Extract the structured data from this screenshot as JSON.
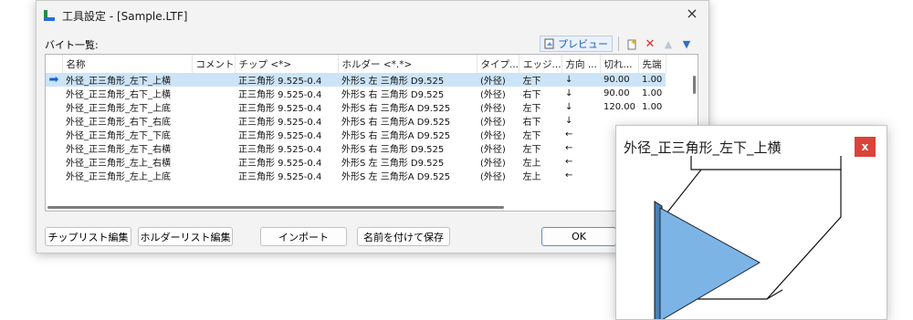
{
  "window": {
    "title": "工具設定 - [Sample.LTF]",
    "close": "×"
  },
  "list_label": "バイト一覧:",
  "toolbar": {
    "preview_label": "プレビュー",
    "icons": [
      "preview-icon",
      "new-icon",
      "delete-icon",
      "move-up-icon",
      "move-down-icon"
    ],
    "delete_color": "#d3302a"
  },
  "table": {
    "columns": [
      "名称",
      "コメント",
      "チップ <*>",
      "ホルダー <*.*>",
      "タイプ...",
      "エッジ...",
      "方向 ...",
      "切れ...",
      "先端"
    ],
    "rows": [
      {
        "name": "外径_正三角形_左下_上横",
        "comment": "",
        "tip": "正三角形 9.525-0.4",
        "holder": "外形S 左 三角形 D9.525",
        "type": "(外径)",
        "edge": "左下",
        "dir": "↓",
        "cut": "90.00",
        "tip2": "1.00",
        "selected": true
      },
      {
        "name": "外径_正三角形_右下_上横",
        "comment": "",
        "tip": "正三角形 9.525-0.4",
        "holder": "外形S 右 三角形 D9.525",
        "type": "(外径)",
        "edge": "右下",
        "dir": "↓",
        "cut": "90.00",
        "tip2": "1.00",
        "selected": false
      },
      {
        "name": "外径_正三角形_左下_上底",
        "comment": "",
        "tip": "正三角形 9.525-0.4",
        "holder": "外形S 右 三角形A D9.525",
        "type": "(外径)",
        "edge": "左下",
        "dir": "↓",
        "cut": "120.00",
        "tip2": "1.00",
        "selected": false
      },
      {
        "name": "外径_正三角形_右下_右底",
        "comment": "",
        "tip": "正三角形 9.525-0.4",
        "holder": "外形S 右 三角形A D9.525",
        "type": "(外径)",
        "edge": "右下",
        "dir": "↓",
        "cut": "",
        "tip2": "",
        "selected": false
      },
      {
        "name": "外径_正三角形_左下_下底",
        "comment": "",
        "tip": "正三角形 9.525-0.4",
        "holder": "外形S 右 三角形A D9.525",
        "type": "(外径)",
        "edge": "左下",
        "dir": "←",
        "cut": "",
        "tip2": "",
        "selected": false
      },
      {
        "name": "外径_正三角形_左下_右横",
        "comment": "",
        "tip": "正三角形 9.525-0.4",
        "holder": "外形S 右 三角形 D9.525",
        "type": "(外径)",
        "edge": "左下",
        "dir": "←",
        "cut": "",
        "tip2": "",
        "selected": false
      },
      {
        "name": "外径_正三角形_左上_右横",
        "comment": "",
        "tip": "正三角形 9.525-0.4",
        "holder": "外形S 左 三角形 D9.525",
        "type": "(外径)",
        "edge": "左上",
        "dir": "←",
        "cut": "",
        "tip2": "",
        "selected": false
      },
      {
        "name": "外径_正三角形_左上_上底",
        "comment": "",
        "tip": "正三角形 9.525-0.4",
        "holder": "外形S 左 三角形A D9.525",
        "type": "(外径)",
        "edge": "左上",
        "dir": "←",
        "cut": "",
        "tip2": "",
        "selected": false
      }
    ]
  },
  "buttons": {
    "tip_list": "チップリスト編集",
    "holder_list": "ホルダーリスト編集",
    "import": "インポート",
    "save_as": "名前を付けて保存",
    "ok": "OK"
  },
  "preview": {
    "title": "外径_正三角形_左下_上横",
    "close": "x",
    "close_color": "#d9433a",
    "insert_color": "#7db4e6"
  }
}
